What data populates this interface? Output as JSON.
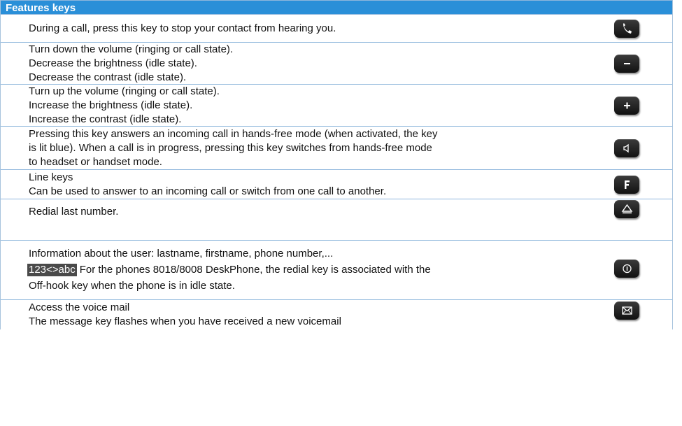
{
  "header": {
    "title": "Features keys"
  },
  "rows": [
    {
      "icon": "mute-handset-key-icon",
      "lines": [
        "During a call, press this key to stop your contact from hearing you."
      ]
    },
    {
      "icon": "volume-down-key-icon",
      "lines": [
        "Turn down the volume (ringing or call state).",
        "Decrease the brightness (idle state).",
        "Decrease the contrast (idle state)."
      ]
    },
    {
      "icon": "volume-up-key-icon",
      "lines": [
        "Turn up the volume (ringing or call state).",
        "Increase the brightness (idle state).",
        "Increase the contrast (idle state)."
      ]
    },
    {
      "icon": "speaker-key-icon",
      "lines": [
        "Pressing this key answers an incoming call in hands-free mode (when activated, the key",
        "is lit blue). When a call is in progress, pressing this key switches from hands-free mode",
        "to headset or handset mode."
      ]
    },
    {
      "icon": "line-key-icon",
      "lines": [
        "Line keys",
        "Can be used to answer to an incoming call or switch from one call to another."
      ]
    },
    {
      "icon": "redial-key-icon",
      "lines": [
        "Redial last number."
      ]
    },
    {
      "icon": "information-key-icon",
      "line1": "Information about the user: lastname, firstname, phone number,...",
      "badge": "123<>abc",
      "line2": "For the phones 8018/8008 DeskPhone, the redial key is associated with the",
      "line3": "Off-hook key when the phone is in idle state."
    },
    {
      "icon": "voicemail-key-icon",
      "lines": [
        "Access the voice mail",
        "The message key flashes when you have received a new voicemail"
      ]
    }
  ]
}
